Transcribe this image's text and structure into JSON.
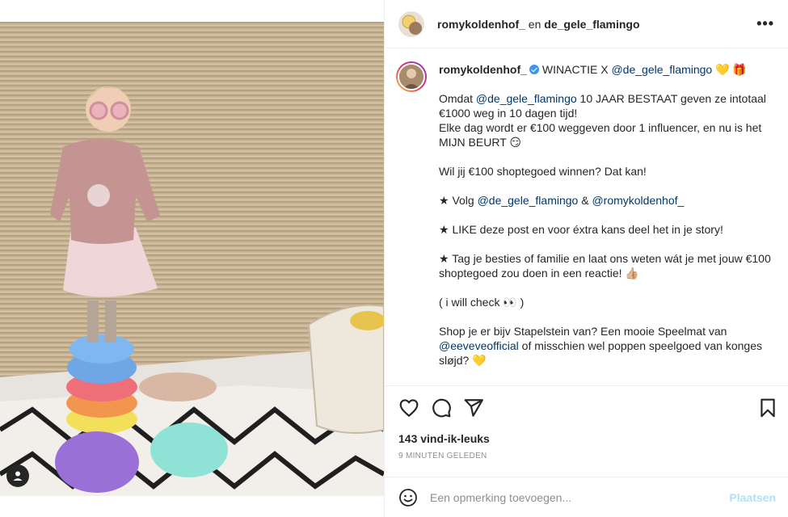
{
  "post": {
    "header": {
      "user1": "romykoldenhof_",
      "connector": "en",
      "user2": "de_gele_flamingo",
      "more_icon": "more-dots-icon"
    },
    "caption": {
      "username": "romykoldenhof_",
      "title": "WINACTIE X",
      "title_mention": "@de_gele_flamingo",
      "title_emoji": "💛 🎁",
      "p1_a": "Omdat ",
      "p1_mention": "@de_gele_flamingo",
      "p1_b": " 10 JAAR BESTAAT geven ze intotaal €1000 weg in 10 dagen tijd!",
      "p2": "Elke dag wordt er €100 weggeven door 1 influencer, en nu is het MIJN BEURT 😏",
      "p3": "Wil jij €100 shoptegoed winnen? Dat kan!",
      "p4_a": "★ Volg ",
      "p4_m1": "@de_gele_flamingo",
      "p4_b": " & ",
      "p4_m2": "@romykoldenhof_",
      "p5": "★ LIKE deze post en voor éxtra kans deel het in je story!",
      "p6": "★ Tag je besties of familie en laat ons weten wát je met jouw €100 shoptegoed zou doen in een reactie! 👍🏼",
      "p7": "( i will check 👀 )",
      "p8_a": "Shop je er bijv Stapelstein van? Een mooie Speelmat van ",
      "p8_mention": "@eeveveofficial",
      "p8_b": " of misschien wel poppen speelgoed van konges sløjd? 💛"
    },
    "likes": "143 vind-ik-leuks",
    "time": "9 MINUTEN GELEDEN",
    "comment": {
      "placeholder": "Een opmerking toevoegen...",
      "post_label": "Plaatsen"
    }
  },
  "colors": {
    "text": "#262626",
    "mention": "#00376b",
    "secondary": "#8e8e8e",
    "post_button_disabled": "#b2dffc",
    "verified": "#3897f0"
  }
}
